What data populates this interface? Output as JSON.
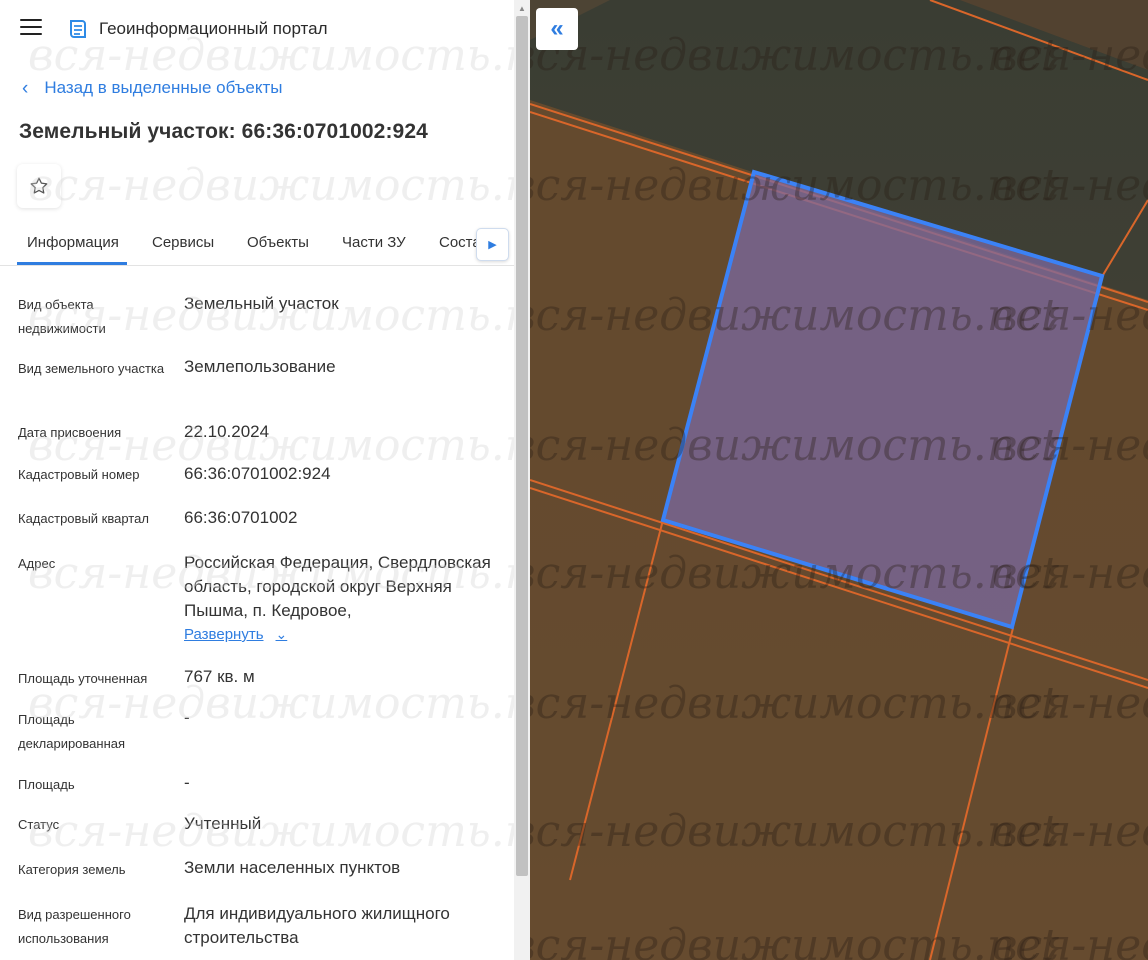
{
  "app": {
    "title": "Геоинформационный портал",
    "menu_icon": "hamburger-icon",
    "logo_icon": "portal-logo-icon"
  },
  "back_link": {
    "label": "Назад в выделенные объекты",
    "icon": "chevron-left-icon"
  },
  "page_title": "Земельный участок: 66:36:0701002:924",
  "favorite_icon": "star-outline-icon",
  "tabs": [
    {
      "label": "Информация",
      "active": true
    },
    {
      "label": "Сервисы",
      "active": false
    },
    {
      "label": "Объекты",
      "active": false
    },
    {
      "label": "Части ЗУ",
      "active": false
    },
    {
      "label": "Соста",
      "active": false
    }
  ],
  "info": [
    {
      "label": "Вид объекта недвижимости",
      "value": "Земельный участок"
    },
    {
      "label": "Вид земельного участка",
      "value": "Землепользование"
    },
    {
      "label": "Дата присвоения",
      "value": "22.10.2024"
    },
    {
      "label": "Кадастровый номер",
      "value": "66:36:0701002:924"
    },
    {
      "label": "Кадастровый квартал",
      "value": "66:36:0701002"
    },
    {
      "label": "Адрес",
      "value": "Российская Федерация, Свердловская область, городской округ Верхняя Пышма, п. Кедровое,"
    },
    {
      "label": "Площадь уточненная",
      "value": "767 кв. м"
    },
    {
      "label": "Площадь декларированная",
      "value": "-"
    },
    {
      "label": "Площадь",
      "value": "-"
    },
    {
      "label": "Статус",
      "value": "Учтенный"
    },
    {
      "label": "Категория земель",
      "value": "Земли населенных пунктов"
    },
    {
      "label": "Вид разрешенного использования",
      "value": "Для индивидуального жилищного строительства"
    }
  ],
  "address_expand": "Развернуть",
  "map": {
    "collapse_icon": "double-chevron-left-icon",
    "selected_parcel_color": "#3b82f6",
    "parcel_fill": "#7b6aa0",
    "boundary_color": "#d9662a"
  },
  "watermark": "вся-недвижимость.net",
  "colors": {
    "accent": "#2f7de0"
  }
}
